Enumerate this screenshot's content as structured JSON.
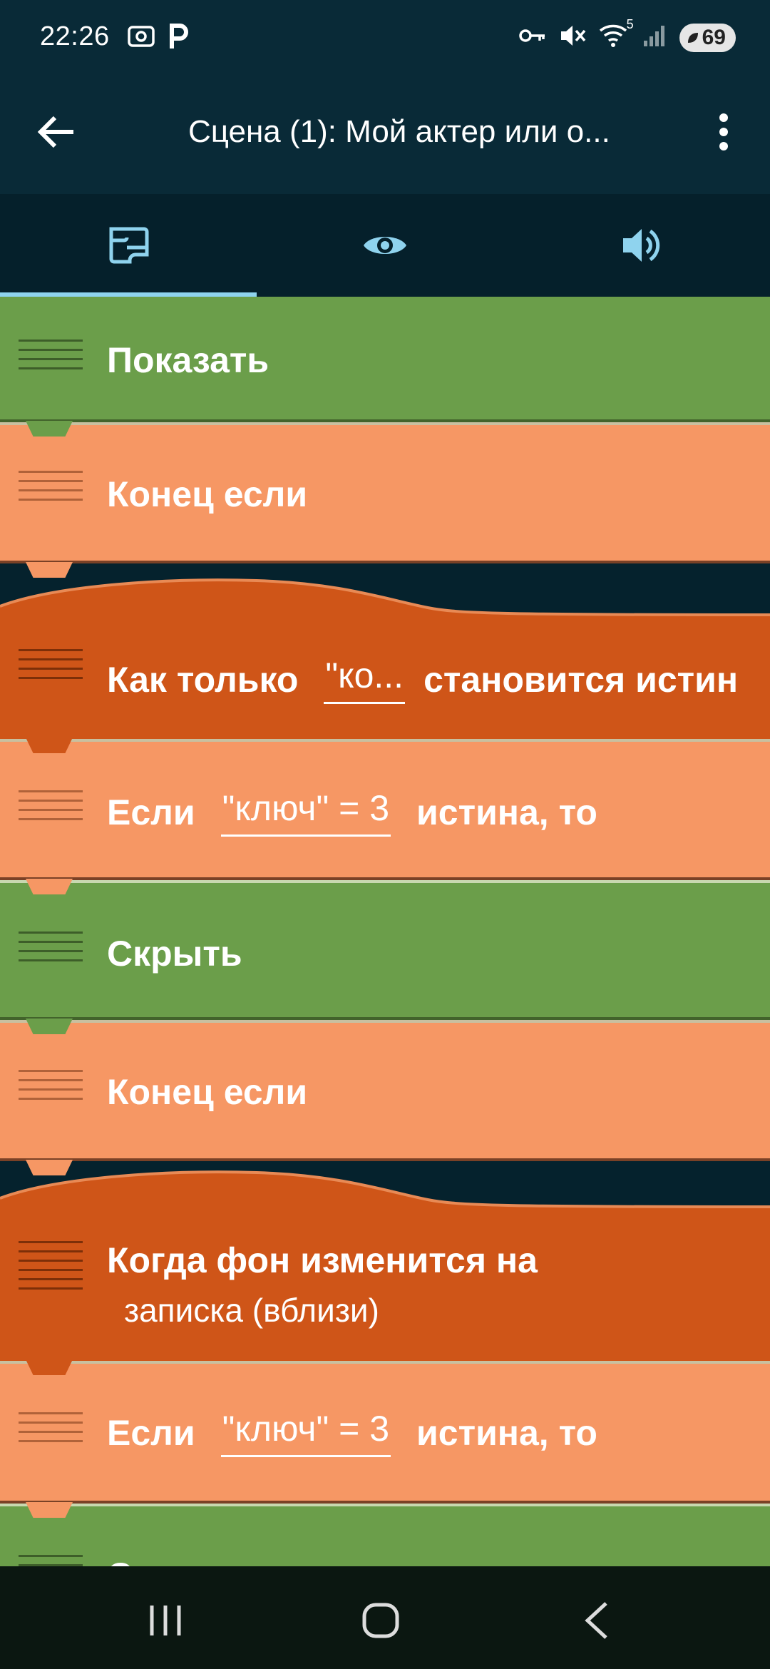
{
  "status_bar": {
    "time": "22:26",
    "left_icons": [
      "screenshot-icon",
      "p-icon"
    ],
    "right_icons": [
      "key-icon",
      "mute-icon",
      "wifi-icon",
      "signal-icon"
    ],
    "wifi_badge": "5",
    "battery": "69"
  },
  "app_bar": {
    "title": "Сцена (1): Мой актер или о..."
  },
  "tabs": [
    {
      "name": "scripts-tab",
      "icon": "script-icon",
      "active": true
    },
    {
      "name": "looks-tab",
      "icon": "eye-icon",
      "active": false
    },
    {
      "name": "sounds-tab",
      "icon": "speaker-icon",
      "active": false
    }
  ],
  "bricks": {
    "b1": {
      "label": "Показать"
    },
    "b2": {
      "label": "Конец если"
    },
    "b3": {
      "label": "Как только",
      "field": "\"ко...",
      "suffix": "становится истин"
    },
    "b4": {
      "label": "Если",
      "field": "\"ключ\" = 3",
      "suffix": "истина, то"
    },
    "b5": {
      "label": "Скрыть"
    },
    "b6": {
      "label": "Конец если"
    },
    "b7": {
      "label": "Когда фон изменится на",
      "value": "записка (вблизи)"
    },
    "b8": {
      "label": "Если",
      "field": "\"ключ\" = 3",
      "suffix": "истина, то"
    },
    "b9": {
      "label": "Скрыть"
    }
  },
  "fabs": {
    "play": "play-icon",
    "add": "plus-icon"
  },
  "nav_bar": [
    "recent-apps-icon",
    "home-icon",
    "back-nav-icon"
  ],
  "colors": {
    "appbar": "#092a37",
    "green_brick": "#6b9e4a",
    "peach_brick": "#f69764",
    "orange_brick": "#cf5518",
    "fab": "#fca50d",
    "tab_indicator": "#8fd3ee"
  }
}
